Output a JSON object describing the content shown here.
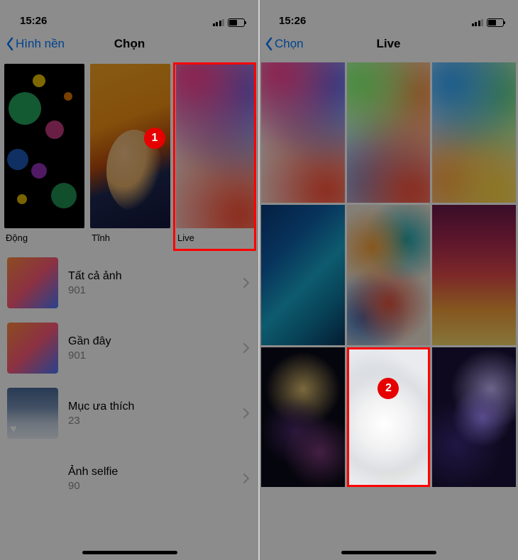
{
  "status": {
    "time": "15:26"
  },
  "left": {
    "nav": {
      "back": "Hình nền",
      "title": "Chọn"
    },
    "categories": [
      {
        "id": "dong",
        "label": "Động"
      },
      {
        "id": "tinh",
        "label": "Tĩnh"
      },
      {
        "id": "live",
        "label": "Live",
        "highlighted": true,
        "step": "1"
      }
    ],
    "albums": [
      {
        "name": "Tất cả ảnh",
        "count": "901"
      },
      {
        "name": "Gần đây",
        "count": "901"
      },
      {
        "name": "Mục ưa thích",
        "count": "23"
      },
      {
        "name": "Ảnh selfie",
        "count": "90"
      }
    ]
  },
  "right": {
    "nav": {
      "back": "Chọn",
      "title": "Live"
    },
    "highlight_index": 7,
    "step": "2"
  }
}
